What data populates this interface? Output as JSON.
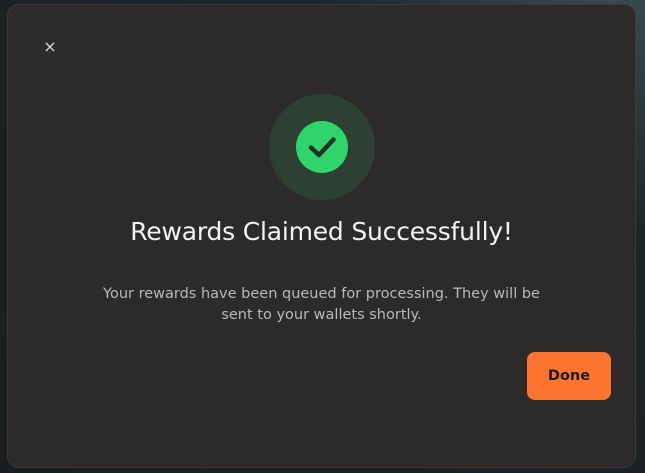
{
  "modal": {
    "close_icon": "close-icon",
    "close_glyph": "×",
    "status_icon": "checkmark-icon",
    "title": "Rewards Claimed Successfully!",
    "message": "Your rewards have been queued for processing. They will be sent to your wallets shortly.",
    "done_label": "Done"
  },
  "colors": {
    "accent": "#fb7530",
    "success": "#2fd46b",
    "background": "#2c2a2a"
  }
}
